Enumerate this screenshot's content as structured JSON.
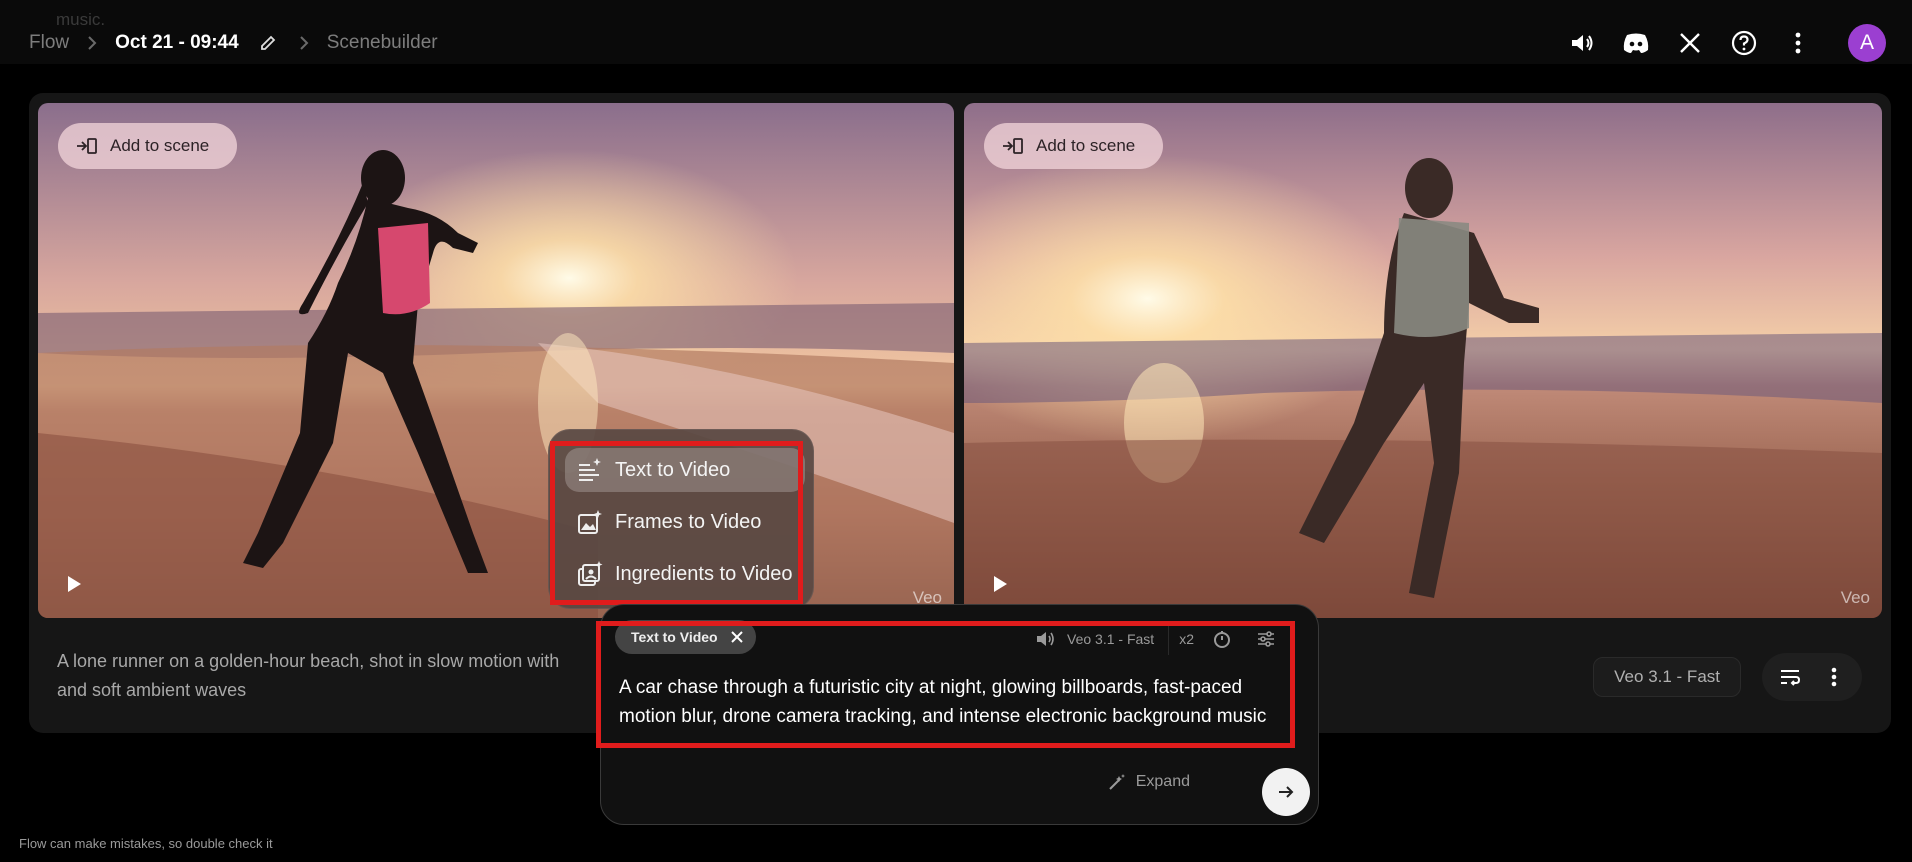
{
  "header": {
    "ghost_text": "music.",
    "breadcrumb_root": "Flow",
    "project_title": "Oct 21 - 09:44",
    "current_page": "Scenebuilder",
    "icons": [
      "volume-icon",
      "discord-icon",
      "x-icon",
      "help-icon",
      "more-vert-icon"
    ],
    "avatar_initial": "A"
  },
  "videos": [
    {
      "add_label": "Add to scene",
      "watermark": "Veo",
      "subject": "woman running on beach at sunset"
    },
    {
      "add_label": "Add to scene",
      "watermark": "Veo",
      "subject": "man running on beach at sunset"
    }
  ],
  "card": {
    "description": "A lone runner on a golden-hour beach, shot in slow motion with",
    "description_line2": "and soft ambient waves",
    "model": "Veo 3.1 - Fast"
  },
  "mode_menu": {
    "items": [
      {
        "label": "Text to Video",
        "icon": "text-sparkle-icon",
        "active": true
      },
      {
        "label": "Frames to Video",
        "icon": "image-sparkle-icon",
        "active": false
      },
      {
        "label": "Ingredients to Video",
        "icon": "ingredients-sparkle-icon",
        "active": false
      }
    ]
  },
  "prompt": {
    "mode_chip": "Text to Video",
    "model": "Veo 3.1 - Fast",
    "count": "x2",
    "text_line1": "A car chase through a futuristic city at night, glowing billboards, fast-paced",
    "text_line2": "motion blur, drone camera tracking, and intense electronic background music",
    "expand_label": "Expand"
  },
  "footer": {
    "disclaimer": "Flow can make mistakes, so double check it"
  },
  "colors": {
    "highlight": "#e01c1c",
    "avatar": "#9b3fd1",
    "background": "#000000"
  }
}
